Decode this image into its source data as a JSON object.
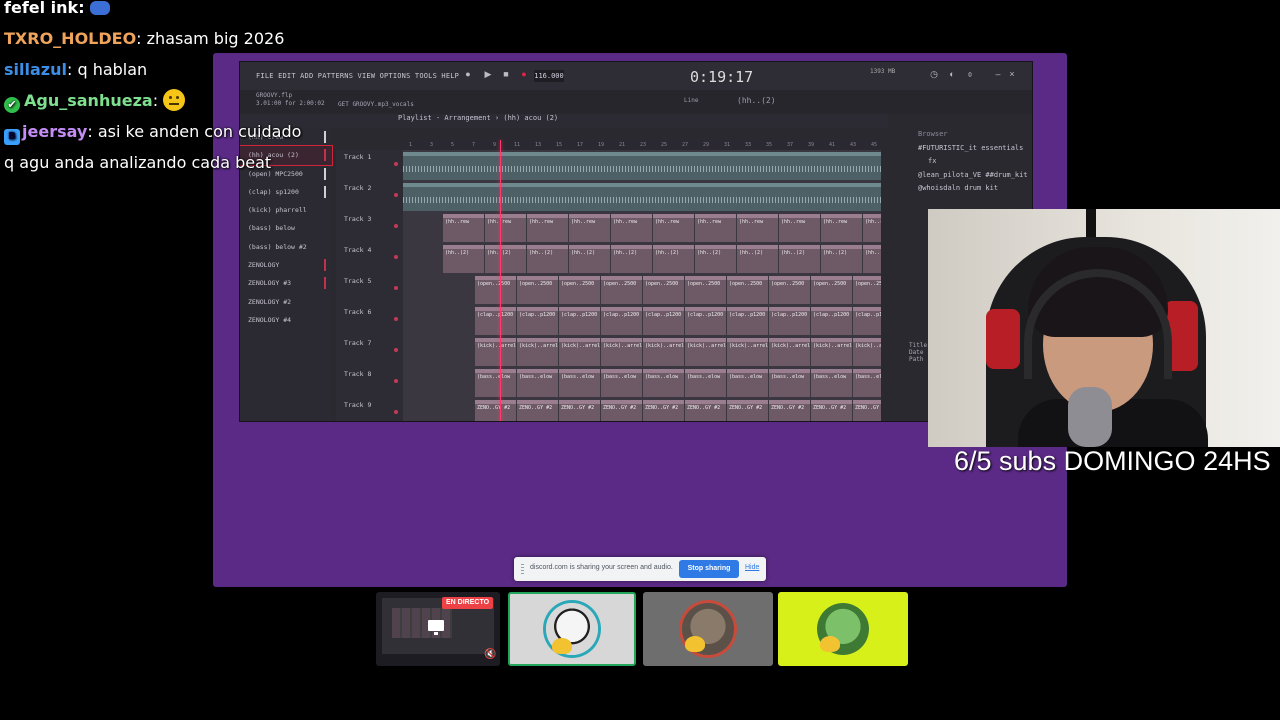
{
  "chat": {
    "lines": [
      {
        "user": "fefel ink:",
        "color": "#ffffff",
        "message": ""
      },
      {
        "user": "TXRO_HOLDEO",
        "color": "#f0a35b",
        "message": ": zhasam big 2026"
      },
      {
        "user": "sillazul",
        "color": "#3d8ee8",
        "message": ": q hablan"
      },
      {
        "user": "Agu_sanhueza",
        "color": "#7ee08f",
        "message": ":"
      },
      {
        "user": "jeersay",
        "color": "#c48cf5",
        "message": ": asi ke anden con cuidado"
      },
      {
        "user": "",
        "color": "#ffffff",
        "message": "q agu anda analizando cada beat"
      }
    ]
  },
  "fl": {
    "menu": "FILE EDIT ADD PATTERNS VIEW OPTIONS TOOLS HELP",
    "tempo": "116.000",
    "time": "0:19:17",
    "project_line1": "GROOVY.flp",
    "project_line2": "3.01:00 for 2:00:02",
    "project_file": "GET GROOVY.mp3_vocals",
    "zoom_label": "(hh..(2)",
    "snap_label": "Line",
    "playlist_title": "Playlist - Arrangement › (hh) acou (2)",
    "patterns": [
      {
        "label": "(hh) crew",
        "mark": "white"
      },
      {
        "label": "(hh) acou (2)",
        "mark": "red",
        "selected": true
      },
      {
        "label": "(open) MPC2500",
        "mark": "white"
      },
      {
        "label": "(clap) sp1200",
        "mark": "white"
      },
      {
        "label": "(kick) pharrell",
        "mark": "none"
      },
      {
        "label": "(bass) below",
        "mark": "none"
      },
      {
        "label": "(bass) below #2",
        "mark": "none"
      },
      {
        "label": "ZENOLOGY",
        "mark": "red"
      },
      {
        "label": "ZENOLOGY #3",
        "mark": "red"
      },
      {
        "label": "ZENOLOGY #2",
        "mark": "none"
      },
      {
        "label": "ZENOLOGY #4",
        "mark": "none"
      }
    ],
    "tracks": [
      "Track 1",
      "Track 2",
      "Track 3",
      "Track 4",
      "Track 5",
      "Track 6",
      "Track 7",
      "Track 8",
      "Track 9"
    ],
    "clip_rows": [
      {
        "row": 2,
        "label": "(hh..rew"
      },
      {
        "row": 3,
        "label": "(hh..(2)"
      },
      {
        "row": 4,
        "label": "(open..2500"
      },
      {
        "row": 5,
        "label": "(clap..p1200"
      },
      {
        "row": 6,
        "label": "(kick)..arrell"
      },
      {
        "row": 7,
        "label": "(bass..elow"
      },
      {
        "row": 8,
        "label": "ZENO..GY #2"
      }
    ],
    "ruler": [
      "1",
      "3",
      "5",
      "7",
      "9",
      "11",
      "13",
      "15",
      "17",
      "19",
      "21",
      "23",
      "25",
      "27",
      "29",
      "31",
      "33",
      "35",
      "37",
      "39",
      "41",
      "43",
      "45"
    ],
    "browser_title": "Browser",
    "browser_items": [
      "#FUTURISTIC_it essentials",
      "fx",
      "@lean_pilota_VE ##drum_kit",
      "@whoisdaln drum kit"
    ],
    "meta": [
      "Title",
      "Date",
      "Path"
    ],
    "cpu": "1393 MB"
  },
  "cam": {
    "label": "6/5 subs DOMINGO 24HS"
  },
  "share": {
    "text": "discord.com is sharing your screen and audio.",
    "stop_label": "Stop sharing",
    "hide_label": "Hide"
  },
  "tiles": {
    "live_label": "EN DIRECTO"
  }
}
